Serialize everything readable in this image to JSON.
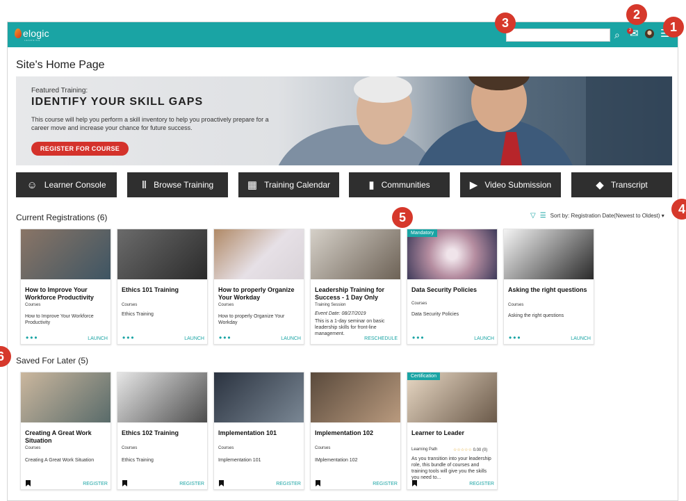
{
  "app": {
    "logo_text": "elogic",
    "logo_subtext": "LEARNING"
  },
  "header": {
    "search_placeholder": "",
    "mail_badge": "2"
  },
  "markers": [
    "1",
    "2",
    "3",
    "4",
    "5",
    "6"
  ],
  "page": {
    "title": "Site's Home Page"
  },
  "hero": {
    "kicker": "Featured Training:",
    "title": "IDENTIFY YOUR SKILL GAPS",
    "description": "This course will help you perform a skill inventory to help you proactively prepare for a career move and increase your chance for future success.",
    "button": "REGISTER FOR COURSE"
  },
  "nav_tiles": [
    {
      "label": "Learner Console",
      "icon": "user-icon"
    },
    {
      "label": "Browse Training",
      "icon": "books-icon"
    },
    {
      "label": "Training Calendar",
      "icon": "calendar-icon"
    },
    {
      "label": "Communities",
      "icon": "chat-icon"
    },
    {
      "label": "Video Submission",
      "icon": "video-icon"
    },
    {
      "label": "Transcript",
      "icon": "graduation-cap-icon"
    }
  ],
  "current_registrations": {
    "title": "Current Registrations (6)",
    "sort_label": "Sort by:",
    "sort_value": "Registration Date(Newest to Oldest)",
    "cards": [
      {
        "title": "How to Improve Your Workforce Productivity",
        "type": "Courses",
        "desc": "How to Improve Your Workforce Productivity",
        "action": "LAUNCH",
        "tag": ""
      },
      {
        "title": "Ethics 101 Training",
        "type": "Courses",
        "desc": "Ethics Training",
        "action": "LAUNCH",
        "tag": ""
      },
      {
        "title": "How to properly Organize Your Workday",
        "type": "Courses",
        "desc": "How to properly Organize Your Workday",
        "action": "LAUNCH",
        "tag": ""
      },
      {
        "title": "Leadership Training for Success - 1 Day Only",
        "type": "Training Session",
        "event": "Event Date: 08/27/2019",
        "desc": "This is a 1-day seminar on basic leadership skills for front-line management.",
        "action": "RESCHEDULE",
        "tag": ""
      },
      {
        "title": "Data Security Policies",
        "type": "Courses",
        "desc": "Data Security Policies",
        "action": "LAUNCH",
        "tag": "Mandatory"
      },
      {
        "title": "Asking the right questions",
        "type": "Courses",
        "desc": "Asking the right questions",
        "action": "LAUNCH",
        "tag": ""
      }
    ]
  },
  "saved_for_later": {
    "title": "Saved For Later (5)",
    "cards": [
      {
        "title": "Creating A Great Work Situation",
        "type": "Courses",
        "desc": "Creating A Great Work Situation",
        "action": "REGISTER",
        "tag": ""
      },
      {
        "title": "Ethics 102 Training",
        "type": "Courses",
        "desc": "Ethics Training",
        "action": "REGISTER",
        "tag": ""
      },
      {
        "title": "Implementation 101",
        "type": "Courses",
        "desc": "Implementation 101",
        "action": "REGISTER",
        "tag": ""
      },
      {
        "title": "Implementation 102",
        "type": "Courses",
        "desc": "IMplementation 102",
        "action": "REGISTER",
        "tag": ""
      },
      {
        "title": "Learner to Leader",
        "type": "Learning Path",
        "rating_stars": "☆☆☆☆☆",
        "rating_value": "0.00 (0)",
        "desc": "As you transition into your leadership role, this bundle of courses and training tools will give you the skills you need to...",
        "action": "REGISTER",
        "tag": "Certification"
      }
    ]
  },
  "colors": {
    "accent": "#1aa4a4",
    "nav_tile": "#2f2f2f",
    "marker": "#d6382b",
    "cta": "#d4322b"
  }
}
